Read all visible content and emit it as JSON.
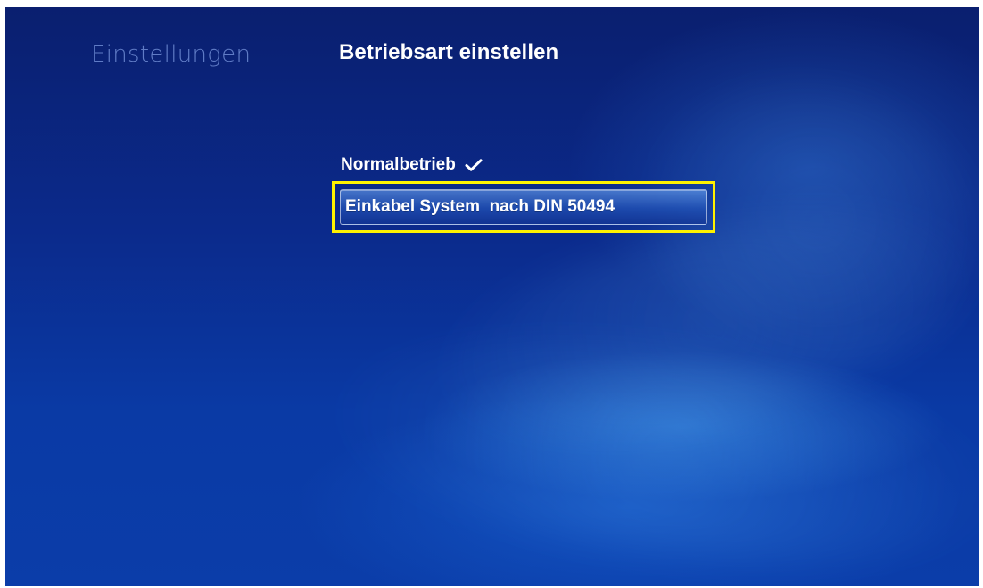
{
  "window": {
    "section_title": "Einstellungen",
    "page_title": "Betriebsart einstellen"
  },
  "options": {
    "normal": {
      "label": "Normalbetrieb",
      "checked": true,
      "icon": "checkmark-icon"
    },
    "einkabel": {
      "label": "Einkabel System  nach DIN 50494",
      "focused": true
    }
  },
  "colors": {
    "focus_border": "#fff200",
    "background_top": "#0a1f6f",
    "background_bottom": "#0b3da9",
    "text": "#ffffff",
    "section_title": "#7896dc"
  }
}
